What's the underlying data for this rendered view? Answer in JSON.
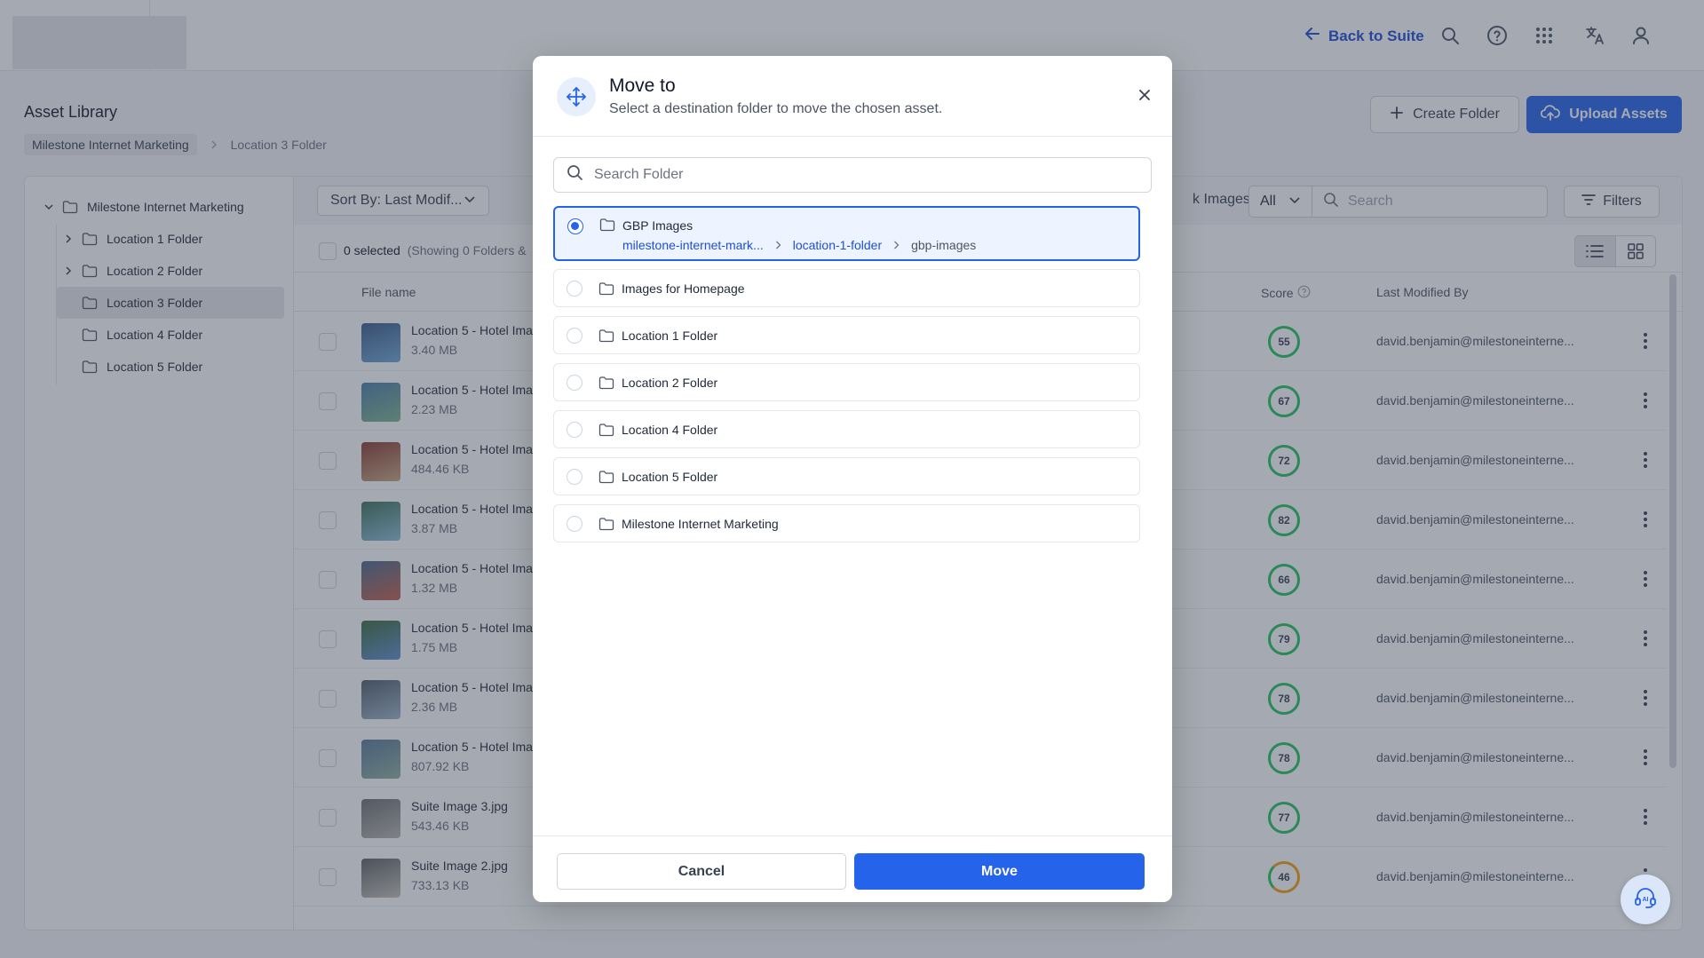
{
  "topbar": {
    "back_label": "Back to Suite",
    "icons": [
      "search-icon",
      "help-icon",
      "apps-grid-icon",
      "translate-icon",
      "user-icon"
    ]
  },
  "page": {
    "title": "Asset Library",
    "breadcrumb": [
      "Milestone Internet Marketing",
      "Location 3 Folder"
    ],
    "create_folder_label": "Create Folder",
    "upload_label": "Upload Assets"
  },
  "tree": {
    "root": "Milestone Internet Marketing",
    "children": [
      {
        "label": "Location 1 Folder",
        "expandable": true
      },
      {
        "label": "Location 2 Folder",
        "expandable": true
      },
      {
        "label": "Location 3 Folder",
        "expandable": false,
        "active": true
      },
      {
        "label": "Location 4 Folder",
        "expandable": false
      },
      {
        "label": "Location 5 Folder",
        "expandable": false
      }
    ]
  },
  "toolbar": {
    "sort_label": "Sort By: Last Modif...",
    "link_images_fragment": "k Images",
    "filter_all": "All",
    "search_placeholder": "Search",
    "filters_label": "Filters"
  },
  "selection": {
    "selected_text": "0 selected",
    "showing_text": "(Showing 0 Folders &"
  },
  "table": {
    "headers": {
      "file": "File name",
      "score": "Score",
      "modified_by": "Last Modified By"
    },
    "rows": [
      {
        "name": "Location 5 - Hotel Ima",
        "size": "3.40 MB",
        "score": "55",
        "modified_by": "david.benjamin@milestoneinterne..."
      },
      {
        "name": "Location 5 - Hotel Ima",
        "size": "2.23 MB",
        "score": "67",
        "modified_by": "david.benjamin@milestoneinterne..."
      },
      {
        "name": "Location 5 - Hotel Ima",
        "size": "484.46 KB",
        "score": "72",
        "modified_by": "david.benjamin@milestoneinterne..."
      },
      {
        "name": "Location 5 - Hotel Ima",
        "size": "3.87 MB",
        "score": "82",
        "modified_by": "david.benjamin@milestoneinterne..."
      },
      {
        "name": "Location 5 - Hotel Ima",
        "size": "1.32 MB",
        "score": "66",
        "modified_by": "david.benjamin@milestoneinterne..."
      },
      {
        "name": "Location 5 - Hotel Ima",
        "size": "1.75 MB",
        "score": "79",
        "modified_by": "david.benjamin@milestoneinterne..."
      },
      {
        "name": "Location 5 - Hotel Ima",
        "size": "2.36 MB",
        "score": "78",
        "modified_by": "david.benjamin@milestoneinterne..."
      },
      {
        "name": "Location 5 - Hotel Ima",
        "size": "807.92 KB",
        "score": "78",
        "modified_by": "david.benjamin@milestoneinterne..."
      },
      {
        "name": "Suite Image 3.jpg",
        "size": "543.46 KB",
        "score": "77",
        "modified_by": "david.benjamin@milestoneinterne..."
      },
      {
        "name": "Suite Image 2.jpg",
        "size": "733.13 KB",
        "score": "46",
        "modified_by": "david.benjamin@milestoneinterne..."
      }
    ]
  },
  "modal": {
    "title": "Move to",
    "subtitle": "Select a destination folder to move the chosen asset.",
    "search_placeholder": "Search Folder",
    "options": [
      {
        "label": "GBP Images",
        "selected": true,
        "path": [
          "milestone-internet-mark...",
          "location-1-folder",
          "gbp-images"
        ]
      },
      {
        "label": "Images for Homepage"
      },
      {
        "label": "Location 1 Folder"
      },
      {
        "label": "Location 2 Folder"
      },
      {
        "label": "Location 4 Folder"
      },
      {
        "label": "Location 5 Folder"
      },
      {
        "label": "Milestone Internet Marketing"
      }
    ],
    "cancel_label": "Cancel",
    "move_label": "Move"
  },
  "colors": {
    "accent": "#2563eb",
    "link": "#1d4ed8",
    "score_good": "#22c55e",
    "score_mid": "#f59e0b"
  }
}
